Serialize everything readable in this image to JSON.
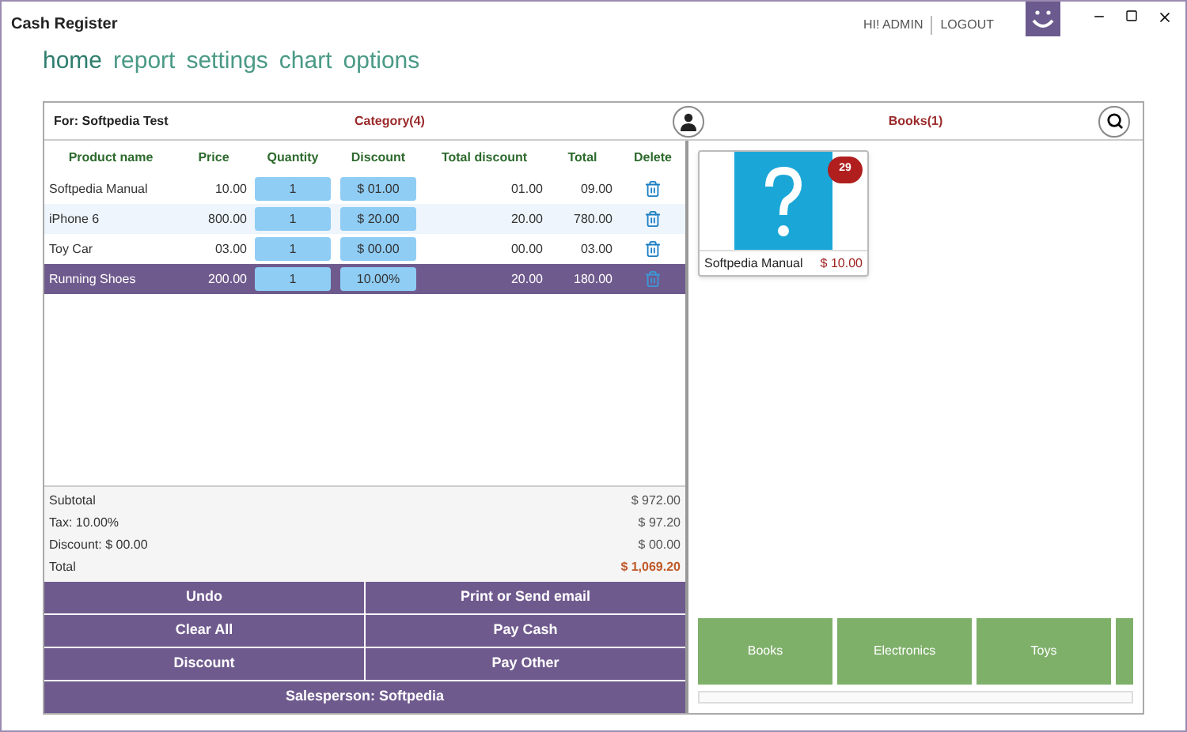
{
  "window": {
    "title": "Cash Register"
  },
  "user": {
    "greeting": "HI! ADMIN",
    "logout": "LOGOUT"
  },
  "nav": [
    {
      "label": "home",
      "selected": true
    },
    {
      "label": "report",
      "selected": false
    },
    {
      "label": "settings",
      "selected": false
    },
    {
      "label": "chart",
      "selected": false
    },
    {
      "label": "options",
      "selected": false
    }
  ],
  "order": {
    "customer": "For: Softpedia Test",
    "category_title": "Category(4)",
    "products_title": "Books(1)"
  },
  "table": {
    "columns": [
      "Product name",
      "Price",
      "Quantity",
      "Discount",
      "Total discount",
      "Total",
      "Delete"
    ],
    "rows": [
      {
        "name": "Softpedia Manual",
        "price": "10.00",
        "quantity": "1",
        "discount": "$ 01.00",
        "total_discount": "01.00",
        "total": "09.00",
        "selected": false
      },
      {
        "name": "iPhone 6",
        "price": "800.00",
        "quantity": "1",
        "discount": "$ 20.00",
        "total_discount": "20.00",
        "total": "780.00",
        "selected": false
      },
      {
        "name": "Toy Car",
        "price": "03.00",
        "quantity": "1",
        "discount": "$ 00.00",
        "total_discount": "00.00",
        "total": "03.00",
        "selected": false
      },
      {
        "name": "Running Shoes",
        "price": "200.00",
        "quantity": "1",
        "discount": "10.00%",
        "total_discount": "20.00",
        "total": "180.00",
        "selected": true
      }
    ]
  },
  "summary": [
    {
      "label": "Subtotal",
      "value": "$ 972.00",
      "kind": "normal"
    },
    {
      "label": "Tax: 10.00%",
      "value": "$ 97.20",
      "kind": "normal"
    },
    {
      "label": "Discount: $ 00.00",
      "value": "$ 00.00",
      "kind": "normal"
    },
    {
      "label": "Total",
      "value": "$ 1,069.20",
      "kind": "total"
    }
  ],
  "buttons": [
    "Undo",
    "Print or Send email",
    "Clear All",
    "Pay Cash",
    "Discount",
    "Pay Other"
  ],
  "salesperson": "Salesperson: Softpedia",
  "products": [
    {
      "name": "Softpedia Manual",
      "price": "$ 10.00",
      "stock": "29"
    }
  ],
  "categories": [
    {
      "kind": "tile",
      "label": "Books"
    },
    {
      "kind": "tile",
      "label": "Electronics"
    },
    {
      "kind": "tile",
      "label": "Toys"
    },
    {
      "kind": "cut"
    }
  ]
}
